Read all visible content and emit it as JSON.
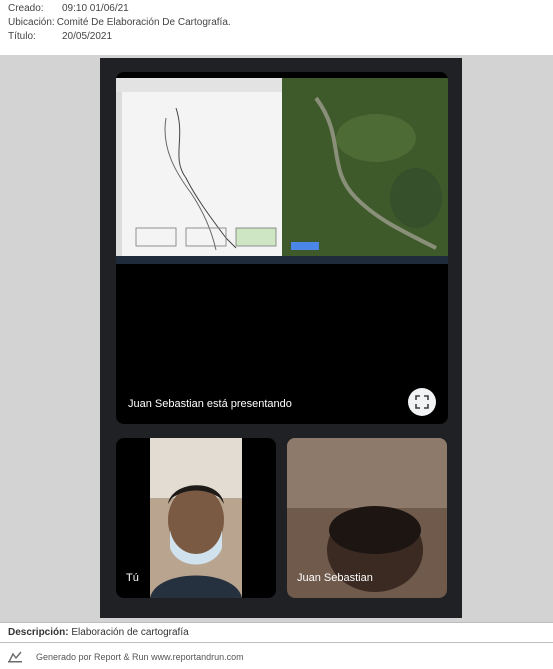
{
  "meta": {
    "created_label": "Creado:",
    "created_value": "09:10 01/06/21",
    "location_label": "Ubicación:",
    "location_value": "Comité De Elaboración De Cartografía.",
    "title_label": "Título:",
    "title_value": "20/05/2021"
  },
  "photo": {
    "presenting_label": "Juan Sebastian está presentando",
    "fullscreen_icon": "fullscreen-icon",
    "tiles": [
      {
        "label": "Tú"
      },
      {
        "label": "Juan Sebastian"
      }
    ]
  },
  "description": {
    "label": "Descripción:",
    "value": "Elaboración de cartografía"
  },
  "footer": {
    "icon": "report-run-logo-icon",
    "text": "Generado por Report & Run www.reportandrun.com"
  },
  "colors": {
    "page_bg": "#ffffff",
    "photo_band": "#d3d3d3",
    "call_bg": "#202124",
    "tile_bg": "#000000",
    "map_green": "#3e5a2a"
  }
}
